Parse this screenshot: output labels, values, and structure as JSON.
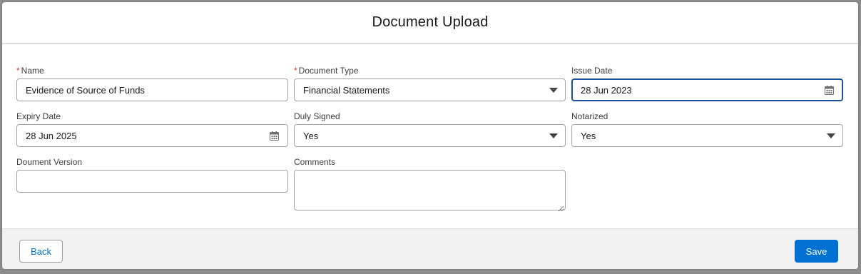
{
  "modal": {
    "title": "Document Upload"
  },
  "form": {
    "name": {
      "label": "Name",
      "required_mark": "*",
      "value": "Evidence of Source of Funds"
    },
    "document_type": {
      "label": "Document Type",
      "required_mark": "*",
      "value": "Financial Statements"
    },
    "issue_date": {
      "label": "Issue Date",
      "value": "28 Jun 2023"
    },
    "expiry_date": {
      "label": "Expiry Date",
      "value": "28 Jun 2025"
    },
    "duly_signed": {
      "label": "Duly Signed",
      "value": "Yes"
    },
    "notarized": {
      "label": "Notarized",
      "value": "Yes"
    },
    "document_version": {
      "label": "Doument Version",
      "value": ""
    },
    "comments": {
      "label": "Comments",
      "value": ""
    }
  },
  "footer": {
    "back_label": "Back",
    "save_label": "Save"
  },
  "colors": {
    "brand_blue": "#0070d2",
    "focus_border": "#1b5297",
    "required_red": "#c23934"
  },
  "icons": {
    "calendar": "calendar-icon",
    "dropdown": "chevron-down-icon"
  }
}
